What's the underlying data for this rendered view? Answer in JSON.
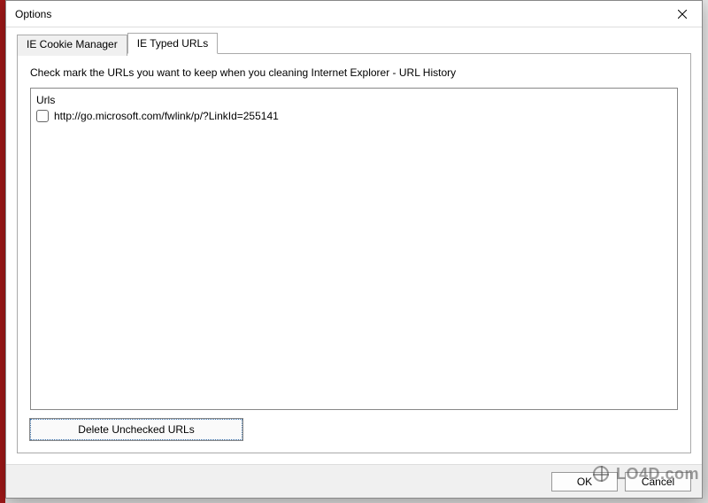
{
  "dialog": {
    "title": "Options"
  },
  "tabs": [
    {
      "label": "IE Cookie Manager",
      "active": false
    },
    {
      "label": "IE Typed URLs",
      "active": true
    }
  ],
  "panel": {
    "instruction": "Check mark the URLs you want to keep when you cleaning Internet Explorer - URL History",
    "list_header": "Urls",
    "urls": [
      {
        "checked": false,
        "url": "http://go.microsoft.com/fwlink/p/?LinkId=255141"
      }
    ],
    "delete_button": "Delete Unchecked URLs"
  },
  "footer": {
    "ok": "OK",
    "cancel": "Cancel"
  },
  "watermark": "LO4D.com"
}
